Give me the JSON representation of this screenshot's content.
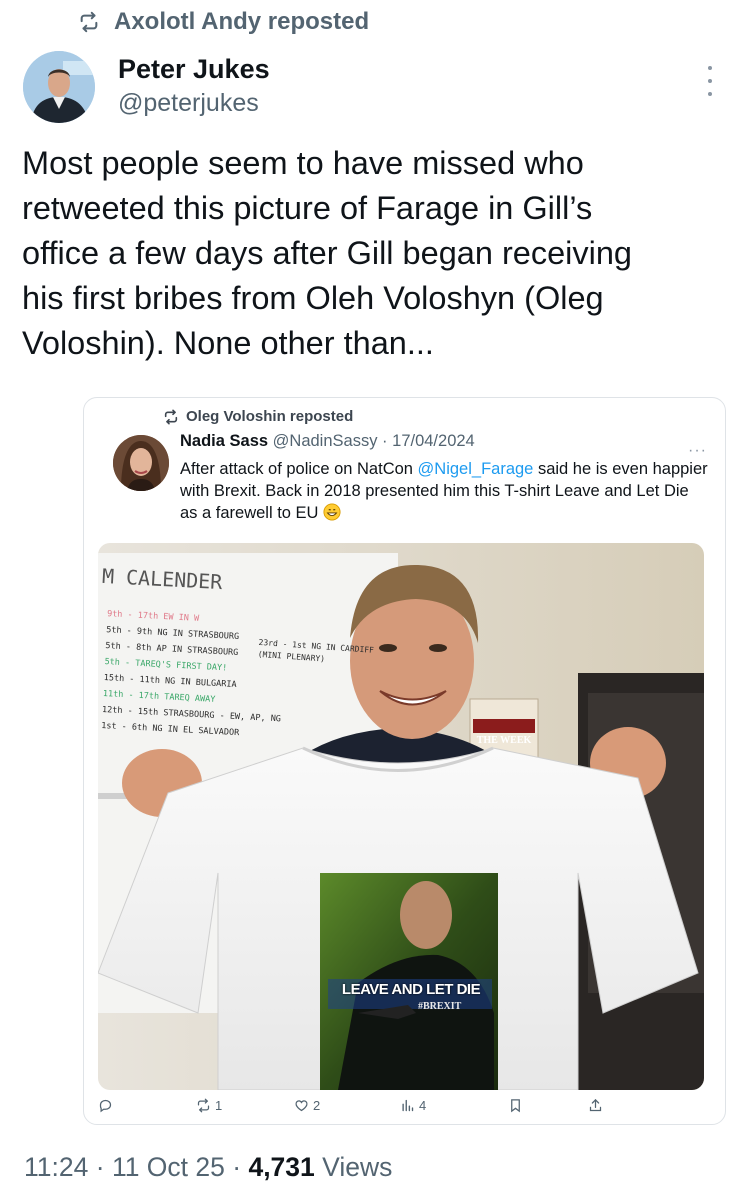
{
  "repost": {
    "label": "Axolotl Andy reposted",
    "icon": "repost-icon"
  },
  "author": {
    "name": "Peter Jukes",
    "handle": "@peterjukes",
    "avatar_icon": "avatar"
  },
  "tweet": {
    "lines": [
      "Most people seem to have missed who",
      "retweeted this picture of Farage in Gill’s",
      "office a few days after Gill began receiving",
      "his first bribes from Oleh Voloshyn (Oleg",
      "Voloshin). None other than..."
    ]
  },
  "quote": {
    "repost_label": "Oleg Voloshin reposted",
    "name": "Nadia Sass",
    "handle": "@NadinSassy",
    "separator": "·",
    "date": "17/04/2024",
    "more": "···",
    "text_before": "After attack of police on NatCon ",
    "mention": "@Nigel_Farage",
    "text_after": " said he is even happier with Brexit. Back in 2018 presented him this T-shirt Leave and Let Die as a farewell to EU",
    "emoji": "grinning-face",
    "photo": {
      "board_title": "M CALENDER",
      "board_lines": [
        "9th - 17th EW IN W",
        "5th - 9th NG IN STRASBOURG",
        "5th - 8th AP IN STRASBOURG",
        "5th - TAREQ'S FIRST DAY!",
        "15th - 11th NG IN BULGARIA",
        "11th - 17th TAREQ AWAY",
        "12th - 15th STRASBOURG - EW, AP, NG",
        "1st - 6th NG IN EL SALVADOR"
      ],
      "board_side": [
        "23rd - 1st NG IN CARDIFF",
        "(MINI PLENARY)"
      ],
      "magazine": "THE WEEK",
      "shirt_title": "LEAVE AND LET DIE",
      "shirt_sub": "#BREXIT"
    },
    "actions": {
      "reply": {
        "icon": "reply-icon",
        "count": ""
      },
      "retweet": {
        "icon": "retweet-icon",
        "count": "1"
      },
      "like": {
        "icon": "heart-icon",
        "count": "2"
      },
      "views": {
        "icon": "views-icon",
        "count": "4"
      },
      "bookmark": {
        "icon": "bookmark-icon",
        "count": ""
      },
      "share": {
        "icon": "share-icon",
        "count": ""
      }
    }
  },
  "footer": {
    "time": "11:24",
    "dot": "·",
    "date": "11 Oct 25",
    "views_count": "4,731",
    "views_label": "Views"
  },
  "colors": {
    "text": "#0f1419",
    "muted": "#536471",
    "link": "#1d9bf0",
    "border": "#dfe3e7"
  }
}
